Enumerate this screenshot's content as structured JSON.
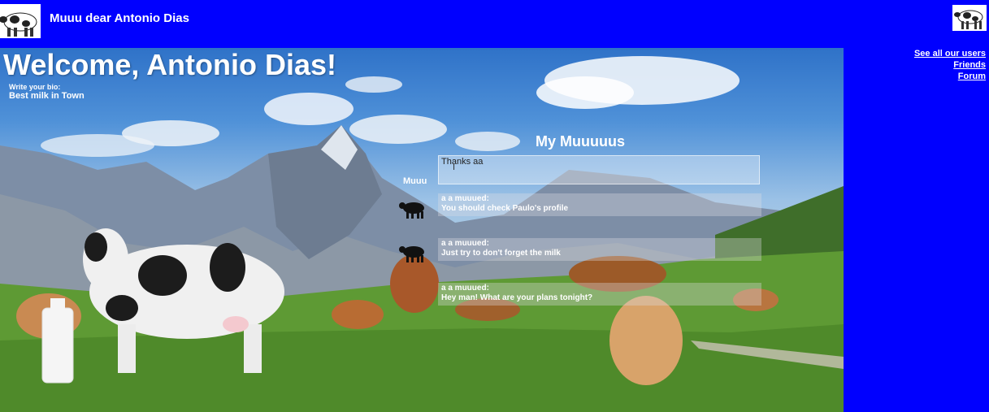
{
  "header": {
    "title": "Muuu dear Antonio Dias",
    "logo_icon": "cow-logo-icon",
    "avatar_icon": "cow-avatar-icon",
    "background": "#0000ff"
  },
  "main": {
    "welcome": "Welcome, Antonio Dias!",
    "bio_label": "Write your bio:",
    "bio_value": "Best milk in Town"
  },
  "muuus": {
    "title": "My Muuuuus",
    "input_label": "Muuu",
    "input_value": "Thanks aa",
    "posts": [
      {
        "author": "a a muuued:",
        "text": "You should check Paulo's profile"
      },
      {
        "author": "a a muuued:",
        "text": "Just try to don't forget the milk"
      },
      {
        "author": "a a muuued:",
        "text": "Hey man! What are your plans tonight?"
      }
    ]
  },
  "nav": {
    "see_all_users": "See all our users",
    "friends": "Friends",
    "forum": "Forum"
  }
}
